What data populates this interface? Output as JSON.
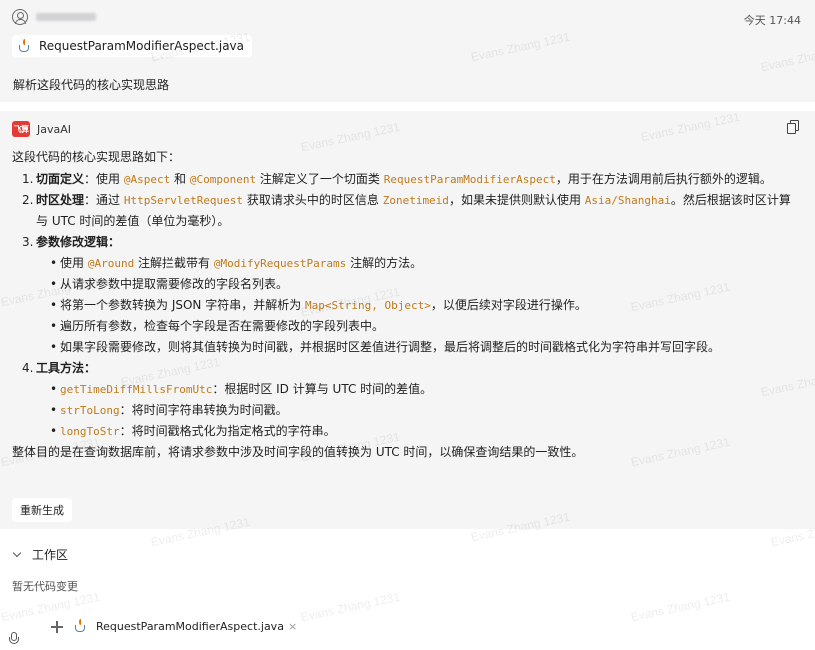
{
  "watermark": "Evans Zhang 1231",
  "user_message": {
    "time": "今天 17:44",
    "file_name": "RequestParamModifierAspect.java",
    "question": "解析这段代码的核心实现思路"
  },
  "ai_message": {
    "assistant_name": "JavaAI",
    "logo_text": "飞算",
    "intro": "这段代码的核心实现思路如下：",
    "items": [
      {
        "num": "1.",
        "title": "切面定义",
        "parts": [
          "：使用 ",
          "@Aspect",
          " 和 ",
          "@Component",
          " 注解定义了一个切面类 ",
          "RequestParamModifierAspect",
          "，用于在方法调用前后执行额外的逻辑。"
        ]
      },
      {
        "num": "2.",
        "title": "时区处理",
        "parts": [
          "：通过 ",
          "HttpServletRequest",
          " 获取请求头中的时区信息 ",
          "Zonetimeid",
          "，如果未提供则默认使用 ",
          "Asia/Shanghai",
          "。然后根据该时区计算与 UTC 时间的差值（单位为毫秒）。"
        ]
      },
      {
        "num": "3.",
        "title": "参数修改逻辑",
        "suffix": "：",
        "bullets": [
          [
            "使用 ",
            "@Around",
            " 注解拦截带有 ",
            "@ModifyRequestParams",
            " 注解的方法。"
          ],
          [
            "从请求参数中提取需要修改的字段名列表。"
          ],
          [
            "将第一个参数转换为 JSON 字符串，并解析为 ",
            "Map<String, Object>",
            "，以便后续对字段进行操作。"
          ],
          [
            "遍历所有参数，检查每个字段是否在需要修改的字段列表中。"
          ],
          [
            "如果字段需要修改，则将其值转换为时间戳，并根据时区差值进行调整，最后将调整后的时间戳格式化为字符串并写回字段。"
          ]
        ]
      },
      {
        "num": "4.",
        "title": "工具方法",
        "suffix": "：",
        "bullets": [
          [
            "",
            "getTimeDiffMillsFromUtc",
            "：根据时区 ID 计算与 UTC 时间的差值。"
          ],
          [
            "",
            "strToLong",
            "：将时间字符串转换为时间戳。"
          ],
          [
            "",
            "longToStr",
            "：将时间戳格式化为指定格式的字符串。"
          ]
        ]
      }
    ],
    "summary": "整体目的是在查询数据库前，将请求参数中涉及时间字段的值转换为 UTC 时间，以确保查询结果的一致性。",
    "regenerate_label": "重新生成"
  },
  "workspace": {
    "title": "工作区",
    "empty_text": "暂无代码变更"
  },
  "input_bar": {
    "attached_file": "RequestParamModifierAspect.java",
    "close_glyph": "×"
  }
}
